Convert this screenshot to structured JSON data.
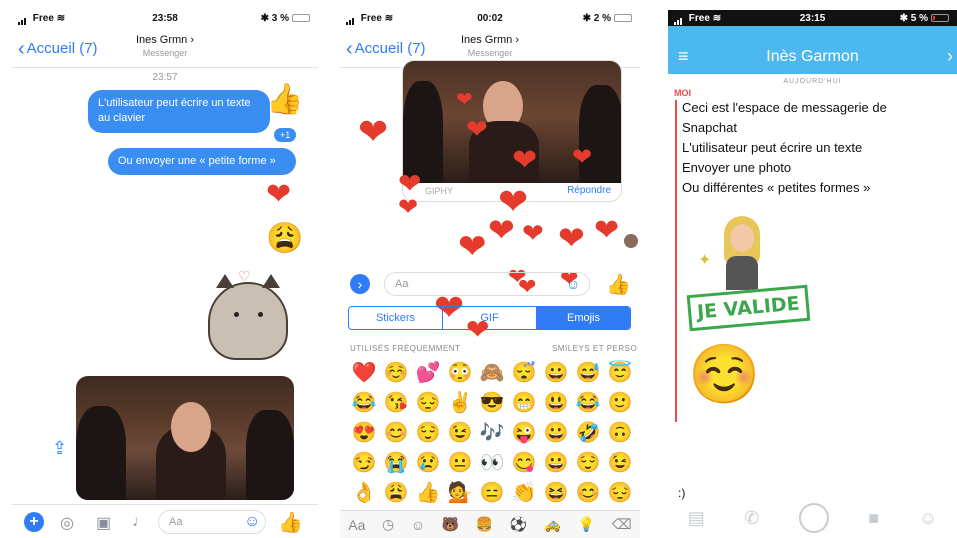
{
  "panel1": {
    "status": {
      "carrier": "Free",
      "time": "23:58",
      "battery": "3 %"
    },
    "back_label": "Accueil (7)",
    "title": "Ines Grmn",
    "title_chevron": "›",
    "subtitle": "Messenger",
    "timestamp": "23:57",
    "messages": [
      "L'utilisateur peut écrire un texte au clavier",
      "Ou envoyer une « petite forme »"
    ],
    "reaction_count": "+1",
    "composer_placeholder": "Aa",
    "colors": {
      "accent": "#2f7cf6",
      "bubble": "#3a8ef2",
      "heart": "#e53b2c"
    }
  },
  "panel2": {
    "status": {
      "carrier": "Free",
      "time": "00:02",
      "battery": "2 %"
    },
    "back_label": "Accueil (7)",
    "title": "Ines Grmn",
    "title_chevron": "›",
    "subtitle": "Messenger",
    "giphy_label": "GIPHY",
    "reply_label": "Répondre",
    "input_placeholder": "Aa",
    "tabs": [
      {
        "label": "Stickers",
        "active": false
      },
      {
        "label": "GIF",
        "active": false
      },
      {
        "label": "Emojis",
        "active": true
      }
    ],
    "section_frequent": "UTILISÉS FRÉQUEMMENT",
    "section_smileys": "SMILEYS ET PERSO",
    "emojis": [
      "❤️",
      "☺️",
      "💕",
      "😳",
      "🙈",
      "😴",
      "😀",
      "😅",
      "😇",
      "😂",
      "😘",
      "😔",
      "✌️",
      "😎",
      "😁",
      "😃",
      "😂",
      "🙂",
      "😍",
      "😊",
      "😌",
      "😉",
      "🎶",
      "😜",
      "😀",
      "🤣",
      "🙃",
      "😏",
      "😭",
      "😢",
      "😐",
      "👀",
      "😋",
      "😀",
      "😌",
      "😉",
      "👌",
      "😩",
      "👍",
      "💁",
      "😑",
      "👏",
      "😆",
      "😊",
      "😔"
    ],
    "keyboard_label": "Aa",
    "category_icons": [
      "clock-icon",
      "smiley-icon",
      "bear-icon",
      "burger-icon",
      "ball-icon",
      "car-icon",
      "bulb-icon",
      "delete-icon"
    ]
  },
  "panel3": {
    "status": {
      "carrier": "Free",
      "time": "23:15",
      "battery": "5 %"
    },
    "title": "Inès Garmon",
    "today_label": "AUJOURD'HUI",
    "sender_label": "MOI",
    "messages": [
      "Ceci est l'espace de messagerie de",
      "Snapchat",
      "L'utilisateur peut écrire un texte",
      "Envoyer une photo",
      "Ou différentes « petites formes »"
    ],
    "sticker_text": "JE VALIDE",
    "input_text": ":)",
    "colors": {
      "header": "#4bb9f0",
      "sender": "#e94c4c",
      "sticker": "#3aa84a"
    }
  }
}
